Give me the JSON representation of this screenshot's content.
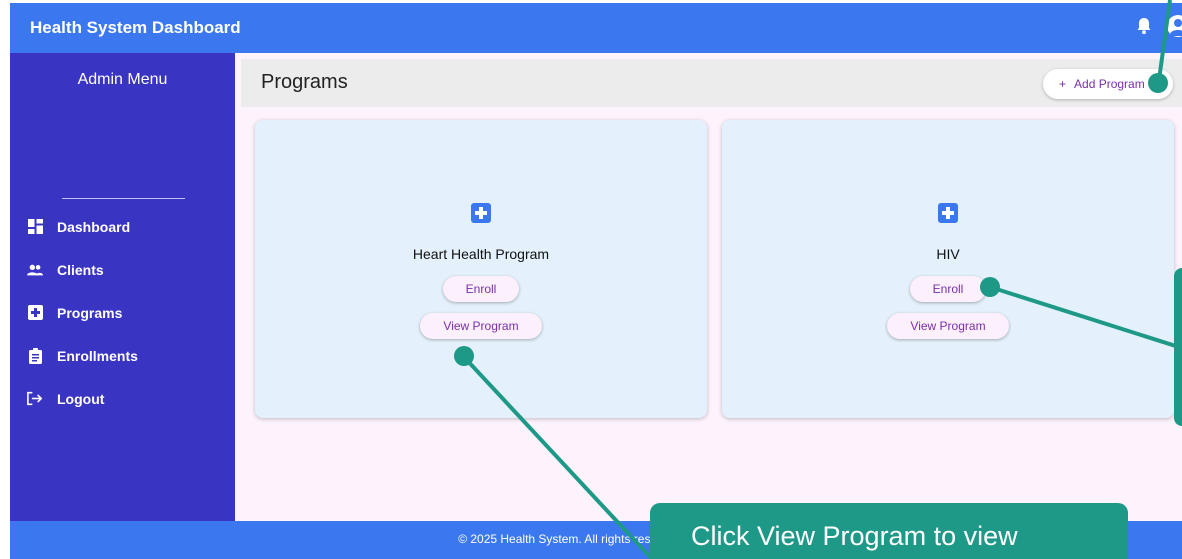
{
  "appbar": {
    "title": "Health System Dashboard",
    "icons": [
      "bell-icon",
      "account-circle-icon"
    ]
  },
  "sidebar": {
    "header": "Admin Menu",
    "items": [
      {
        "label": "Dashboard",
        "icon": "dashboard-icon"
      },
      {
        "label": "Clients",
        "icon": "people-icon"
      },
      {
        "label": "Programs",
        "icon": "medical-plus-icon"
      },
      {
        "label": "Enrollments",
        "icon": "clipboard-icon"
      },
      {
        "label": "Logout",
        "icon": "logout-icon"
      }
    ]
  },
  "page": {
    "title": "Programs",
    "add_button": {
      "plus": "+",
      "label": "Add Program"
    }
  },
  "programs": [
    {
      "name": "Heart Health Program",
      "enroll": "Enroll",
      "view": "View Program"
    },
    {
      "name": "HIV",
      "enroll": "Enroll",
      "view": "View Program"
    }
  ],
  "footer": {
    "text": "© 2025 Health System. All rights reserved."
  },
  "tutorial": {
    "tooltip_text": "Click View Program to view"
  },
  "colors": {
    "appbar": "#3b78f0",
    "sidebar": "#3a34c2",
    "accent_text": "#7b2fa8",
    "card_bg": "#e4f1fc",
    "tutorial": "#1e9887"
  }
}
